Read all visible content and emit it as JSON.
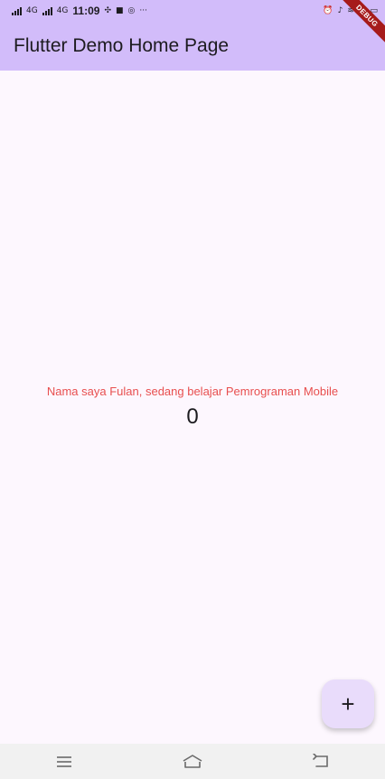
{
  "status_bar": {
    "network_1": "4G",
    "network_2": "4G",
    "time": "11:09",
    "more": "···"
  },
  "app_bar": {
    "title": "Flutter Demo Home Page"
  },
  "debug_banner": "DEBUG",
  "content": {
    "description": "Nama saya Fulan, sedang belajar Pemrograman Mobile",
    "counter": "0"
  },
  "fab": {
    "icon": "+"
  },
  "nav_bar": {
    "icons": [
      "menu-icon",
      "home-icon",
      "back-icon"
    ]
  },
  "colors": {
    "primary_container": "#d2bcfa",
    "background": "#fdf7fe",
    "description_text": "#e84f4f",
    "fab_background": "#e9dcfb",
    "debug_banner": "#a61b1b"
  }
}
